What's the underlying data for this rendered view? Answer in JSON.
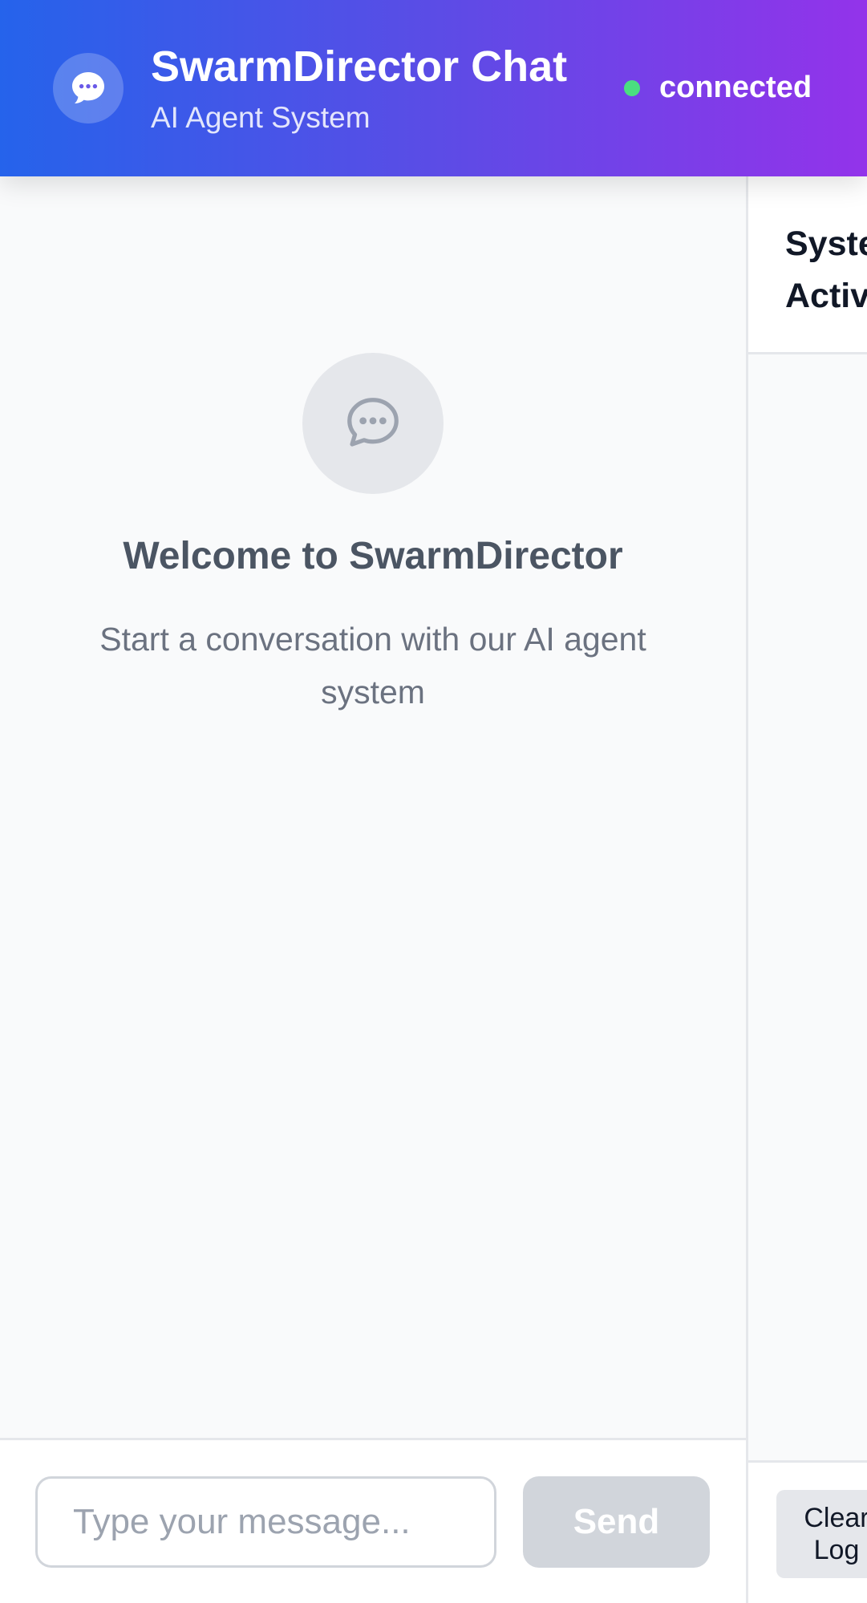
{
  "header": {
    "title": "SwarmDirector Chat",
    "subtitle": "AI Agent System",
    "status": "connected",
    "status_color": "#4ade80",
    "logo_icon": "chat-bubble-icon"
  },
  "chat": {
    "welcome_icon": "chat-bubble-icon",
    "welcome_title": "Welcome to SwarmDirector",
    "welcome_text": "Start a conversation with our AI agent system"
  },
  "composer": {
    "placeholder": "Type your message...",
    "value": "",
    "send_label": "Send"
  },
  "side_panel": {
    "title": "System Activity",
    "clear_label": "Clear Log"
  },
  "colors": {
    "header_gradient_start": "#2563eb",
    "header_gradient_end": "#9333ea",
    "send_disabled": "#d1d5db"
  }
}
